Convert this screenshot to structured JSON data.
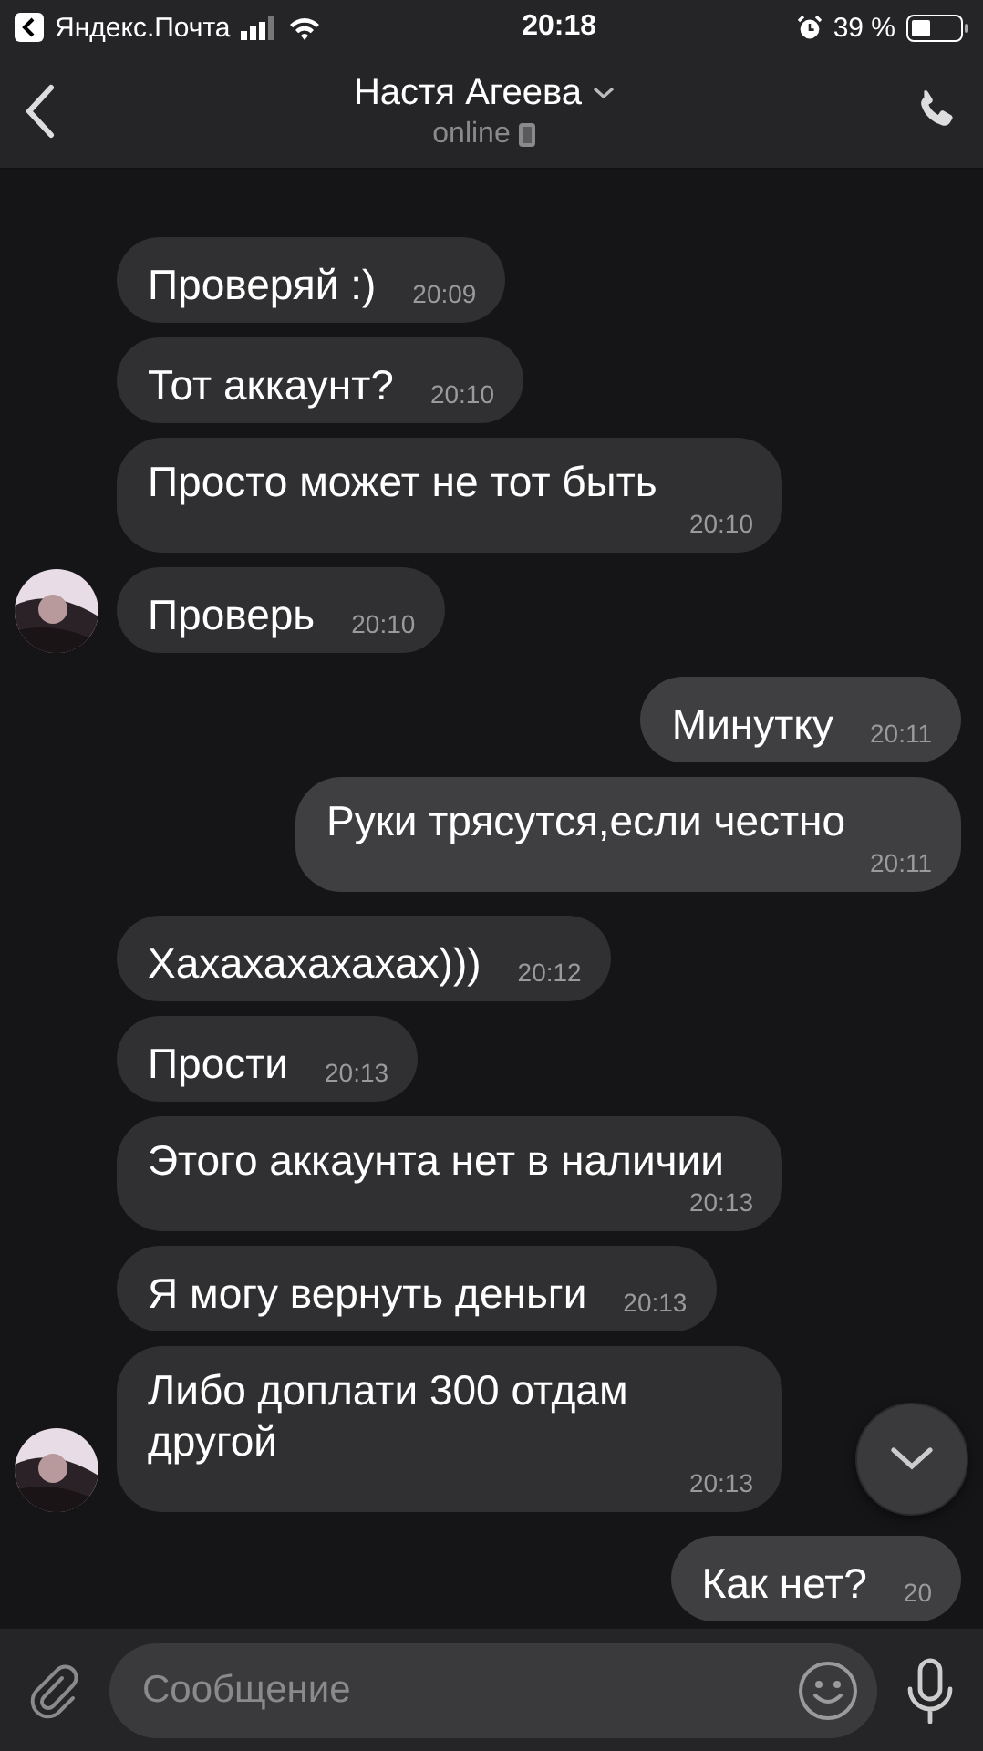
{
  "status_bar": {
    "back_app": "Яндекс.Почта",
    "time": "20:18",
    "battery": "39 %"
  },
  "header": {
    "name": "Настя Агеева",
    "status": "online"
  },
  "messages": [
    {
      "kind": "in",
      "text": "Проверяй :)",
      "time": "20:09",
      "avatar": false
    },
    {
      "kind": "in",
      "text": "Тот аккаунт?",
      "time": "20:10",
      "avatar": false
    },
    {
      "kind": "in",
      "text": "Просто может не тот быть",
      "time": "20:10",
      "avatar": false
    },
    {
      "kind": "in",
      "text": "Проверь",
      "time": "20:10",
      "avatar": true
    },
    {
      "kind": "out",
      "text": "Минутку",
      "time": "20:11"
    },
    {
      "kind": "out",
      "text": "Руки трясутся,если честно",
      "time": "20:11"
    },
    {
      "kind": "in",
      "text": "Хахахахахахах)))",
      "time": "20:12",
      "avatar": false
    },
    {
      "kind": "in",
      "text": "Прости",
      "time": "20:13",
      "avatar": false
    },
    {
      "kind": "in",
      "text": "Этого аккаунта нет в наличии",
      "time": "20:13",
      "avatar": false
    },
    {
      "kind": "in",
      "text": "Я могу вернуть деньги",
      "time": "20:13",
      "avatar": false
    },
    {
      "kind": "in",
      "text": "Либо доплати 300 отдам другой",
      "time": "20:13",
      "avatar": true
    },
    {
      "kind": "out",
      "text": "Как нет?",
      "time": "20"
    }
  ],
  "composer": {
    "placeholder": "Сообщение"
  }
}
